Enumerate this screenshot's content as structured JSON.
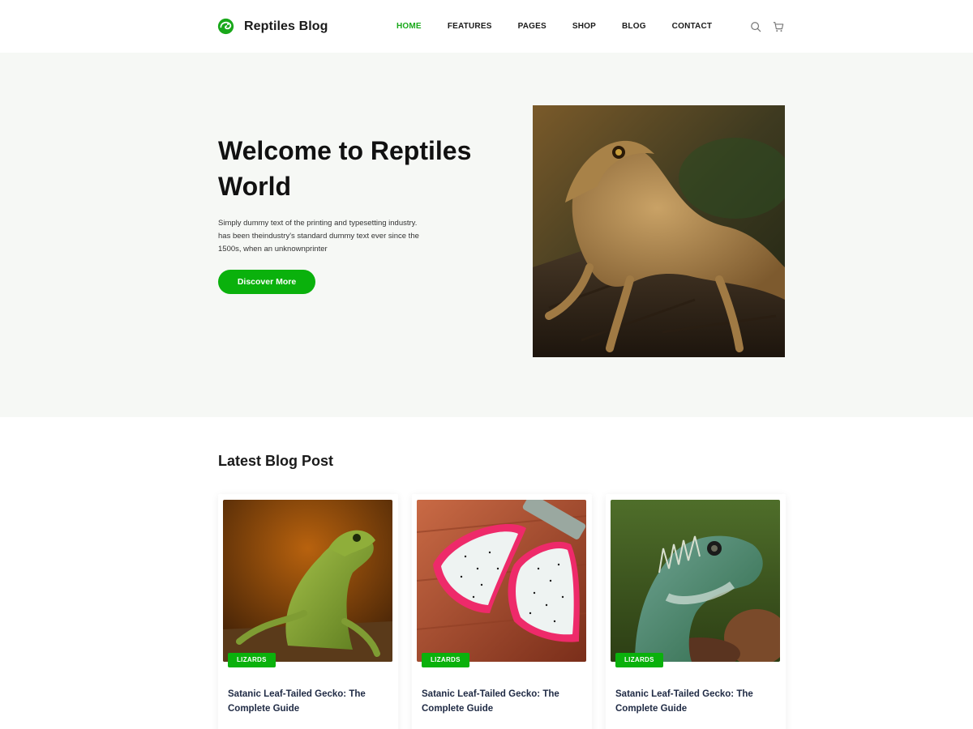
{
  "brand": {
    "name": "Reptiles Blog",
    "accent": "#0ab10c"
  },
  "nav": {
    "items": [
      {
        "label": "HOME",
        "active": true
      },
      {
        "label": "FEATURES",
        "active": false
      },
      {
        "label": "PAGES",
        "active": false
      },
      {
        "label": "SHOP",
        "active": false
      },
      {
        "label": "BLOG",
        "active": false
      },
      {
        "label": "CONTACT",
        "active": false
      }
    ],
    "icons": [
      "search-icon",
      "cart-icon"
    ]
  },
  "hero": {
    "title": "Welcome to Reptiles World",
    "text": "Simply dummy text of the printing and typesetting industry. has been theindustry's standard dummy text ever since the 1500s, when an unknownprinter",
    "button_label": "Discover More",
    "image": "bearded-dragon-on-log-photo"
  },
  "blog": {
    "section_title": "Latest Blog Post",
    "posts": [
      {
        "category": "LIZARDS",
        "title": "Satanic Leaf-Tailed Gecko: The Complete Guide",
        "image": "green-lizard-photo"
      },
      {
        "category": "LIZARDS",
        "title": "Satanic Leaf-Tailed Gecko: The Complete Guide",
        "image": "dragon-fruit-photo"
      },
      {
        "category": "LIZARDS",
        "title": "Satanic Leaf-Tailed Gecko: The Complete Guide",
        "image": "iguana-photo"
      }
    ]
  }
}
